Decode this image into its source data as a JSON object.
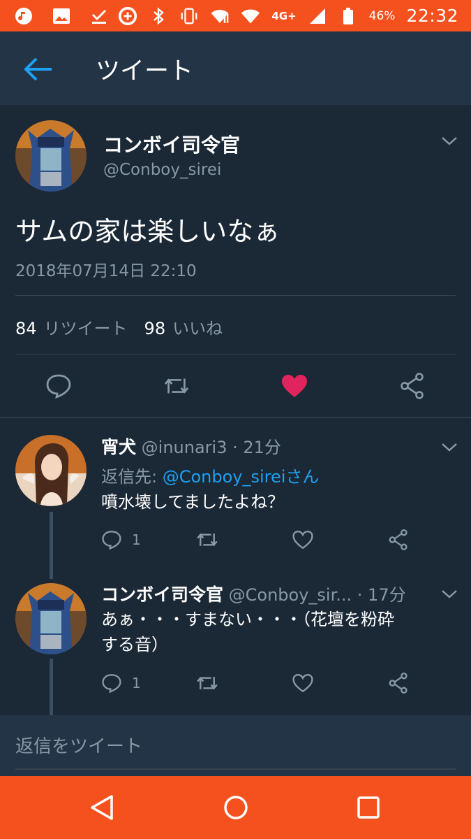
{
  "status_bar": {
    "network": "4G+",
    "battery": "46%",
    "time": "22:32"
  },
  "header": {
    "title": "ツイート"
  },
  "tweet": {
    "author_name": "コンボイ司令官",
    "author_handle": "@Conboy_sirei",
    "text": "サムの家は楽しいなぁ",
    "timestamp": "2018年07月14日 22:10",
    "retweet_count": "84",
    "retweet_label": "リツイート",
    "like_count": "98",
    "like_label": "いいね",
    "liked_color": "#e0245e"
  },
  "replies": [
    {
      "author_name": "宵犬",
      "author_handle": "@inunari3",
      "time": "· 21分",
      "reply_to_prefix": "返信先: ",
      "reply_to_mention": "@Conboy_sirei",
      "reply_to_suffix": "さん",
      "text": "噴水壊してましたよね？",
      "reply_count": "1"
    },
    {
      "author_name": "コンボイ司令官",
      "author_handle": "@Conboy_sir...",
      "time": "· 17分",
      "text_line1": "あぁ・・・すまない・・・（花壇を粉砕",
      "text_line2": "する音）",
      "reply_count": "1"
    }
  ],
  "composer": {
    "placeholder": "返信をツイート"
  },
  "colors": {
    "status_bar": "#f4511e",
    "app_bar": "#243447",
    "background": "#1b2836",
    "accent": "#1da1f2",
    "muted": "#8899a6"
  }
}
